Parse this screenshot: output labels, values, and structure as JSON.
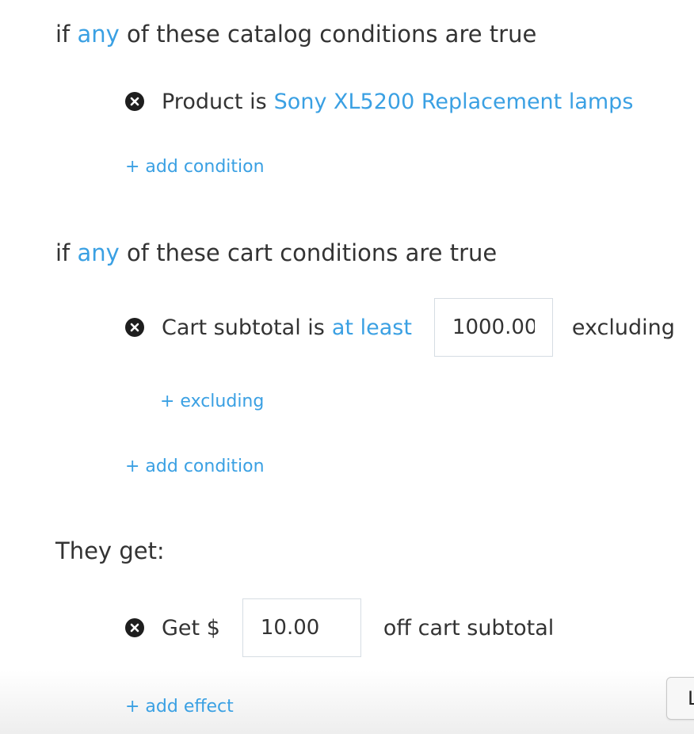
{
  "catalog": {
    "heading_prefix": "if",
    "any_label": "any",
    "heading_suffix": "of these catalog conditions are true",
    "condition": {
      "label": "Product is",
      "product_link": "Sony XL5200 Replacement lamps"
    },
    "add_condition": "+ add condition"
  },
  "cart": {
    "heading_prefix": "if",
    "any_label": "any",
    "heading_suffix": "of these cart conditions are true",
    "condition": {
      "label": "Cart subtotal is",
      "operator_link": "at least",
      "amount_value": "1000.00",
      "excluding_label": "excluding"
    },
    "add_excluding": "+ excluding",
    "add_condition": "+ add condition"
  },
  "effects": {
    "heading": "They get:",
    "effect": {
      "label": "Get $",
      "amount_value": "10.00",
      "suffix": "off cart subtotal"
    },
    "add_effect": "+ add effect"
  },
  "corner_button_label": "L",
  "colors": {
    "link": "#3aa0e3",
    "text": "#333333",
    "icon": "#1e1e1e",
    "input_border": "#d6dde3"
  },
  "icons": {
    "remove": "close-circle-icon"
  }
}
